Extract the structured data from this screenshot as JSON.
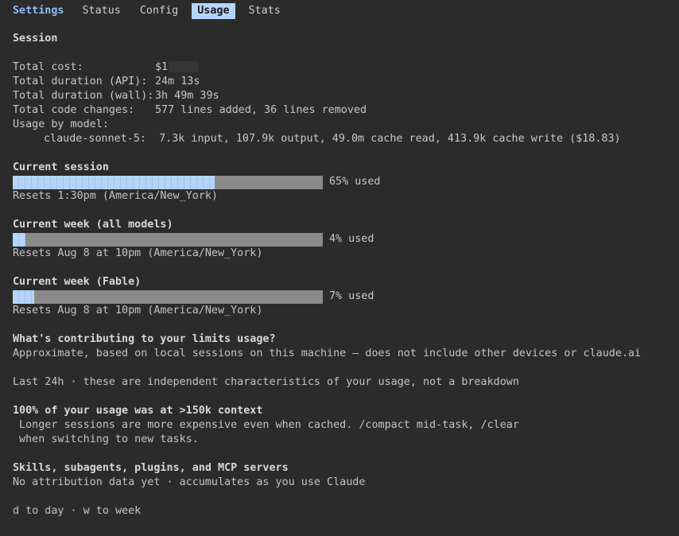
{
  "tabs": {
    "title": "Settings",
    "items": [
      "Status",
      "Config",
      "Usage",
      "Stats"
    ],
    "active": "Usage"
  },
  "session": {
    "heading": "Session",
    "total_cost_label": "Total cost:",
    "total_cost_value": "$1",
    "api_duration_label": "Total duration (API):",
    "api_duration_value": "24m 13s",
    "wall_duration_label": "Total duration (wall):",
    "wall_duration_value": "3h 49m 39s",
    "code_changes_label": "Total code changes:",
    "code_changes_value": "577 lines added, 36 lines removed",
    "usage_by_model_label": "Usage by model:",
    "model_name": "claude-sonnet-5:",
    "model_usage": "7.3k input, 107.9k output, 49.0m cache read, 413.9k cache write ($18.83)"
  },
  "limits": [
    {
      "heading": "Current session",
      "fraction": 0.65,
      "used_label": "65% used",
      "reset": "Resets 1:30pm (America/New_York)"
    },
    {
      "heading": "Current week (all models)",
      "fraction": 0.04,
      "used_label": "4% used",
      "reset": "Resets Aug 8 at 10pm (America/New_York)"
    },
    {
      "heading": "Current week (Fable)",
      "fraction": 0.07,
      "used_label": "7% used",
      "reset": "Resets Aug 8 at 10pm (America/New_York)"
    }
  ],
  "contrib": {
    "heading": "What's contributing to your limits usage?",
    "subtitle": "Approximate, based on local sessions on this machine — does not include other devices or claude.ai",
    "window_note": "Last 24h · these are independent characteristics of your usage, not a breakdown",
    "context_heading": "100% of your usage was at >150k context",
    "context_line1": " Longer sessions are more expensive even when cached. /compact mid-task, /clear",
    "context_line2": " when switching to new tasks.",
    "skills_heading": "Skills, subagents, plugins, and MCP servers",
    "skills_note": "No attribution data yet · accumulates as you use Claude"
  },
  "footer": {
    "hint": "d to day · w to week"
  },
  "colors": {
    "background": "#2b2b2b",
    "accent": "#b4d4fb",
    "bar_track": "#8a8a8a"
  }
}
